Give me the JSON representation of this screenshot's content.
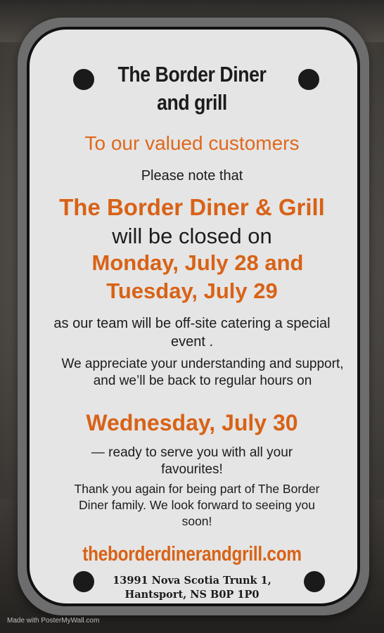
{
  "sign": {
    "header_line1": "The Border Diner",
    "header_line2": "and grill",
    "greeting": "To our valued customers",
    "note": "Please note that",
    "name": "The Border Diner & Grill",
    "closed": "will be closed on",
    "date1": "Monday, July 28 and",
    "date2": "Tuesday, July 29",
    "reason": "as our team will be off-site catering a special event .",
    "appreciate": "We appreciate your understanding and support, and we’ll be back to regular hours on",
    "reopen_date": "Wednesday, July 30",
    "ready": "— ready to serve you with all your favourites!",
    "thanks": "Thank you again for being part of The Border Diner family. We look forward to seeing you soon!",
    "website": "theborderdinerandgrill.com",
    "address_line1": "13991 Nova Scotia Trunk 1,",
    "address_line2": "Hantsport, NS B0P 1P0"
  },
  "watermark": "Made with PosterMyWall.com",
  "colors": {
    "accent": "#d86216",
    "text": "#1c1c1c"
  }
}
